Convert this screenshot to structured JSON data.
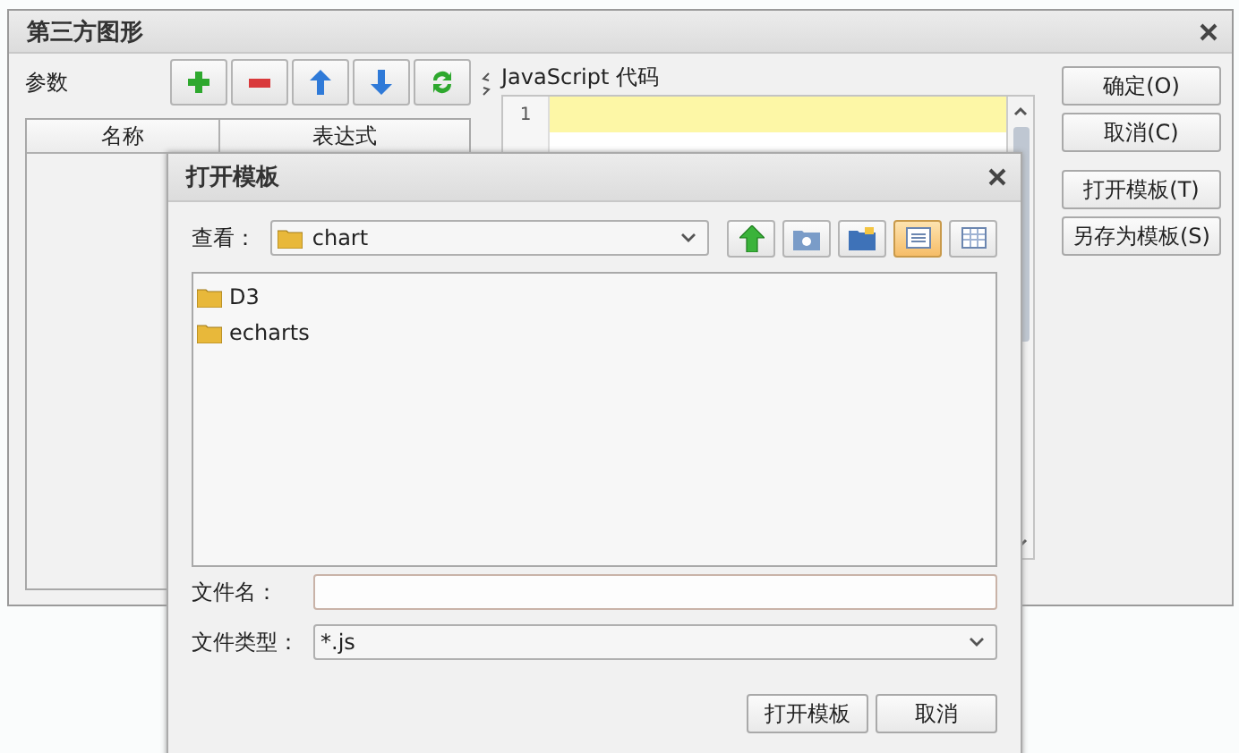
{
  "main_window": {
    "title": "第三方图形",
    "params_label": "参数",
    "toolbar": [
      {
        "kind": "add"
      },
      {
        "kind": "remove"
      },
      {
        "kind": "up"
      },
      {
        "kind": "down"
      },
      {
        "kind": "refresh"
      }
    ],
    "table": {
      "columns": [
        "名称",
        "表达式"
      ]
    },
    "code_label": "JavaScript 代码",
    "code_editor": {
      "line_numbers": [
        "1"
      ]
    },
    "buttons": [
      "确定(O)",
      "取消(C)",
      "打开模板(T)",
      "另存为模板(S)"
    ]
  },
  "dialog": {
    "title": "打开模板",
    "look_in_label": "查看：",
    "look_in_value": "chart",
    "nav_buttons": [
      {
        "kind": "up",
        "selected": false
      },
      {
        "kind": "home",
        "selected": false
      },
      {
        "kind": "new-folder",
        "selected": false
      },
      {
        "kind": "list",
        "selected": true
      },
      {
        "kind": "details",
        "selected": false
      }
    ],
    "files": [
      {
        "name": "D3"
      },
      {
        "name": "echarts"
      }
    ],
    "file_name_label": "文件名：",
    "file_type_label": "文件类型：",
    "file_type_value": "*.js",
    "buttons": [
      "打开模板",
      "取消"
    ]
  }
}
